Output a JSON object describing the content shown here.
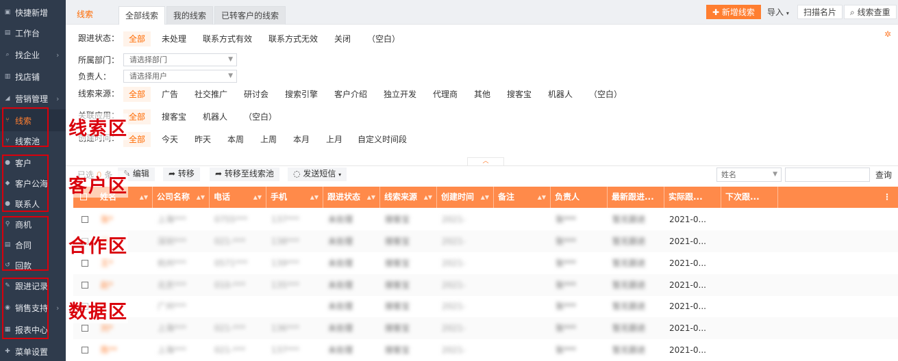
{
  "sidebar": {
    "items": [
      {
        "icon": "plus-square-icon",
        "glyph": "▣",
        "label": "快捷新增",
        "arrow": ""
      },
      {
        "icon": "desk-icon",
        "glyph": "▤",
        "label": "工作台",
        "arrow": ""
      },
      {
        "icon": "search-icon",
        "glyph": "⌕",
        "label": "找企业",
        "arrow": "›"
      },
      {
        "icon": "shop-icon",
        "glyph": "▥",
        "label": "找店铺",
        "arrow": ""
      },
      {
        "icon": "megaphone-icon",
        "glyph": "◢",
        "label": "营销管理",
        "arrow": "›"
      },
      {
        "icon": "leads-icon",
        "glyph": "⑂",
        "label": "线索",
        "arrow": "",
        "active": true
      },
      {
        "icon": "leads-pool-icon",
        "glyph": "⑂",
        "label": "线索池",
        "arrow": ""
      },
      {
        "icon": "person-icon",
        "glyph": "●",
        "label": "客户",
        "arrow": ""
      },
      {
        "icon": "customers-group-icon",
        "glyph": "◆",
        "label": "客户公海",
        "arrow": ""
      },
      {
        "icon": "contacts-icon",
        "glyph": "●",
        "label": "联系人",
        "arrow": ""
      },
      {
        "icon": "location-pin-icon",
        "glyph": "⚲",
        "label": "商机",
        "arrow": ""
      },
      {
        "icon": "contract-icon",
        "glyph": "▤",
        "label": "合同",
        "arrow": ""
      },
      {
        "icon": "refund-icon",
        "glyph": "↺",
        "label": "回款",
        "arrow": ""
      },
      {
        "icon": "edit-record-icon",
        "glyph": "✎",
        "label": "跟进记录",
        "arrow": ""
      },
      {
        "icon": "support-icon",
        "glyph": "◉",
        "label": "销售支持",
        "arrow": "›"
      },
      {
        "icon": "chart-icon",
        "glyph": "▦",
        "label": "报表中心",
        "arrow": ""
      },
      {
        "icon": "plus-icon",
        "glyph": "✚",
        "label": "菜单设置",
        "arrow": ""
      }
    ],
    "zones": [
      "线索区",
      "客户区",
      "合作区",
      "数据区"
    ]
  },
  "header": {
    "title": "线索",
    "tabs": [
      "全部线索",
      "我的线索",
      "已转客户的线索"
    ],
    "new_button": "新增线索",
    "import_button": "导入",
    "scan_button": "扫描名片",
    "check_button": "线索查重"
  },
  "filters": {
    "status_label": "跟进状态：",
    "status_options": [
      "全部",
      "未处理",
      "联系方式有效",
      "联系方式无效",
      "关闭",
      "（空白）"
    ],
    "dept_label": "所属部门：",
    "dept_placeholder": "请选择部门",
    "owner_label": "负责人：",
    "owner_placeholder": "请选择用户",
    "source_label": "线索来源：",
    "source_options": [
      "全部",
      "广告",
      "社交推广",
      "研讨会",
      "搜索引擎",
      "客户介绍",
      "独立开发",
      "代理商",
      "其他",
      "搜客宝",
      "机器人",
      "（空白）"
    ],
    "assoc_label": "关联应用：",
    "assoc_options": [
      "全部",
      "搜客宝",
      "机器人",
      "（空白）"
    ],
    "created_label": "创建时间：",
    "created_options": [
      "全部",
      "今天",
      "昨天",
      "本周",
      "上周",
      "本月",
      "上月",
      "自定义时间段"
    ]
  },
  "actions": {
    "selected_prefix": "已选",
    "selected_count": "0",
    "selected_suffix": "条",
    "edit": "编辑",
    "transfer": "转移",
    "to_pool": "转移至线索池",
    "sms": "发送短信",
    "search_field": "姓名",
    "search_button": "查询"
  },
  "table": {
    "columns": [
      "姓名",
      "公司名称",
      "电话",
      "手机",
      "跟进状态",
      "线索来源",
      "创建时间",
      "备注",
      "负责人",
      "最新跟进...",
      "实际跟...",
      "下次跟..."
    ],
    "rows": [
      {
        "name": "张*",
        "company": "上海***",
        "phone": "0755***",
        "mobile": "137***",
        "status": "未处理",
        "source": "搜客宝",
        "created": "2021-",
        "owner": "张***",
        "latest": "暂无跟进",
        "actual": "2021-0..."
      },
      {
        "name": "李*",
        "company": "深圳***",
        "phone": "021-***",
        "mobile": "138***",
        "status": "未处理",
        "source": "搜客宝",
        "created": "2021-",
        "owner": "张***",
        "latest": "暂无跟进",
        "actual": "2021-0..."
      },
      {
        "name": "王*",
        "company": "杭州***",
        "phone": "0571***",
        "mobile": "139***",
        "status": "未处理",
        "source": "搜客宝",
        "created": "2021-",
        "owner": "张***",
        "latest": "暂无跟进",
        "actual": "2021-0..."
      },
      {
        "name": "赵*",
        "company": "北京***",
        "phone": "010-***",
        "mobile": "135***",
        "status": "未处理",
        "source": "搜客宝",
        "created": "2021-",
        "owner": "张***",
        "latest": "暂无跟进",
        "actual": "2021-0..."
      },
      {
        "name": "",
        "company": "广州***",
        "phone": "",
        "mobile": "",
        "status": "未处理",
        "source": "搜客宝",
        "created": "2021-",
        "owner": "张***",
        "latest": "暂无跟进",
        "actual": "2021-0..."
      },
      {
        "name": "刘*",
        "company": "上海***",
        "phone": "021-***",
        "mobile": "136***",
        "status": "未处理",
        "source": "搜客宝",
        "created": "2021-",
        "owner": "张***",
        "latest": "暂无跟进",
        "actual": "2021-0..."
      },
      {
        "name": "陈**",
        "company": "上海***",
        "phone": "021-***",
        "mobile": "137***",
        "status": "未处理",
        "source": "搜客宝",
        "created": "2021-",
        "owner": "张***",
        "latest": "暂无跟进",
        "actual": "2021-0..."
      }
    ]
  },
  "colors": {
    "accent": "#ff7e30",
    "sidebar": "#2f3b4c",
    "zone_red": "#d9000b"
  }
}
